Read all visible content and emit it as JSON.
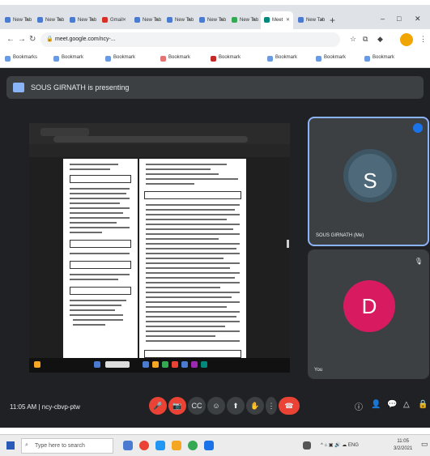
{
  "browser": {
    "tabs": [
      {
        "label": "New Tab"
      },
      {
        "label": "New Tab"
      },
      {
        "label": "New Tab"
      },
      {
        "label": "Gmail"
      },
      {
        "label": "New Tab"
      },
      {
        "label": "New Tab"
      },
      {
        "label": "New Tab"
      },
      {
        "label": "New Tab"
      },
      {
        "label": "Meet"
      },
      {
        "label": "New Tab"
      }
    ],
    "url": "meet.google.com/ncy-...",
    "bookmarks": [
      "Bookmarks",
      "Bookmark",
      "Bookmark",
      "Bookmark",
      "Bookmark",
      "Bookmark",
      "Bookmark",
      "Bookmark"
    ]
  },
  "meet": {
    "presenting_text": "SOUS GIRNATH is presenting",
    "tile_s": {
      "initial": "S",
      "name": "SOUS GIRNATH (Me)"
    },
    "tile_d": {
      "initial": "D",
      "name": "You"
    },
    "time": "11:05 AM",
    "meeting_code": "ncy-cbvp-ptw"
  },
  "taskbar": {
    "search_placeholder": "Type here to search",
    "clock_time": "11:05",
    "clock_date": "3/2/2021"
  }
}
